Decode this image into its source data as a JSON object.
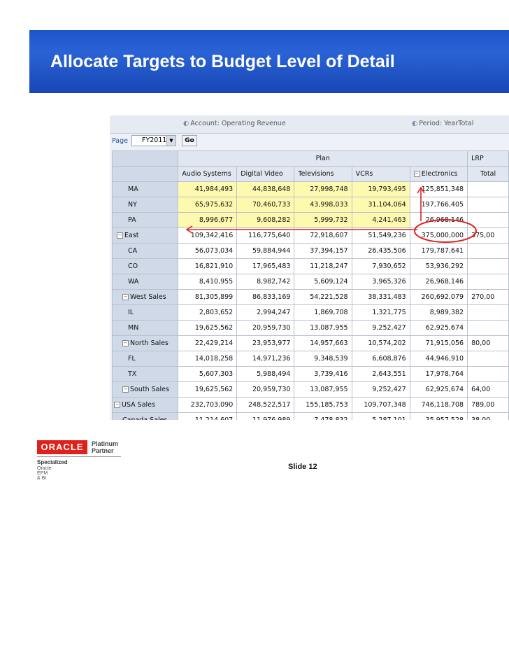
{
  "slide": {
    "title": "Allocate Targets to Budget Level of Detail",
    "slide_number": "Slide 12"
  },
  "pov": {
    "account": "Account: Operating Revenue",
    "period": "Period: YearTotal"
  },
  "page_bar": {
    "label": "Page",
    "selected": "FY2011",
    "go_label": "Go"
  },
  "grid": {
    "group_headers": [
      "Plan",
      "LRP"
    ],
    "columns": [
      "Audio Systems",
      "Digital Video",
      "Televisions",
      "VCRs",
      "Electronics",
      "Total"
    ],
    "rows": [
      {
        "label": "MA",
        "values": [
          "41,984,493",
          "44,838,648",
          "27,998,748",
          "19,793,495",
          "125,851,348",
          ""
        ]
      },
      {
        "label": "NY",
        "values": [
          "65,975,632",
          "70,460,733",
          "43,998,033",
          "31,104,064",
          "197,766,405",
          ""
        ]
      },
      {
        "label": "PA",
        "values": [
          "8,996,677",
          "9,608,282",
          "5,999,732",
          "4,241,463",
          "26,968,146",
          ""
        ]
      },
      {
        "label": "East",
        "values": [
          "109,342,416",
          "116,775,640",
          "72,918,607",
          "51,549,236",
          "375,000,000",
          "375,00"
        ]
      },
      {
        "label": "CA",
        "values": [
          "56,073,034",
          "59,884,944",
          "37,394,157",
          "26,435,506",
          "179,787,641",
          ""
        ]
      },
      {
        "label": "CO",
        "values": [
          "16,821,910",
          "17,965,483",
          "11,218,247",
          "7,930,652",
          "53,936,292",
          ""
        ]
      },
      {
        "label": "WA",
        "values": [
          "8,410,955",
          "8,982,742",
          "5,609,124",
          "3,965,326",
          "26,968,146",
          ""
        ]
      },
      {
        "label": "West Sales",
        "values": [
          "81,305,899",
          "86,833,169",
          "54,221,528",
          "38,331,483",
          "260,692,079",
          "270,00"
        ]
      },
      {
        "label": "IL",
        "values": [
          "2,803,652",
          "2,994,247",
          "1,869,708",
          "1,321,775",
          "8,989,382",
          ""
        ]
      },
      {
        "label": "MN",
        "values": [
          "19,625,562",
          "20,959,730",
          "13,087,955",
          "9,252,427",
          "62,925,674",
          ""
        ]
      },
      {
        "label": "North Sales",
        "values": [
          "22,429,214",
          "23,953,977",
          "14,957,663",
          "10,574,202",
          "71,915,056",
          "80,00"
        ]
      },
      {
        "label": "FL",
        "values": [
          "14,018,258",
          "14,971,236",
          "9,348,539",
          "6,608,876",
          "44,946,910",
          ""
        ]
      },
      {
        "label": "TX",
        "values": [
          "5,607,303",
          "5,988,494",
          "3,739,416",
          "2,643,551",
          "17,978,764",
          ""
        ]
      },
      {
        "label": "South Sales",
        "values": [
          "19,625,562",
          "20,959,730",
          "13,087,955",
          "9,252,427",
          "62,925,674",
          "64,00"
        ]
      },
      {
        "label": "USA Sales",
        "values": [
          "232,703,090",
          "248,522,517",
          "155,185,753",
          "109,707,348",
          "746,118,708",
          "789,00"
        ]
      },
      {
        "label": "Canada Sales",
        "values": [
          "11,214,607",
          "11,976,989",
          "7,478,832",
          "5,287,101",
          "35,957,528",
          "38,00"
        ]
      }
    ]
  },
  "logo": {
    "brand": "ORACLE",
    "partner_line1": "Platinum",
    "partner_line2": "Partner",
    "specialized": "Specialized",
    "specialty": "Oracle EPM & BI"
  },
  "colors": {
    "banner": "#1f54c9",
    "highlight_cells": "#fdfab0",
    "annotation": "#e02020",
    "oracle_red": "#e0201b"
  }
}
